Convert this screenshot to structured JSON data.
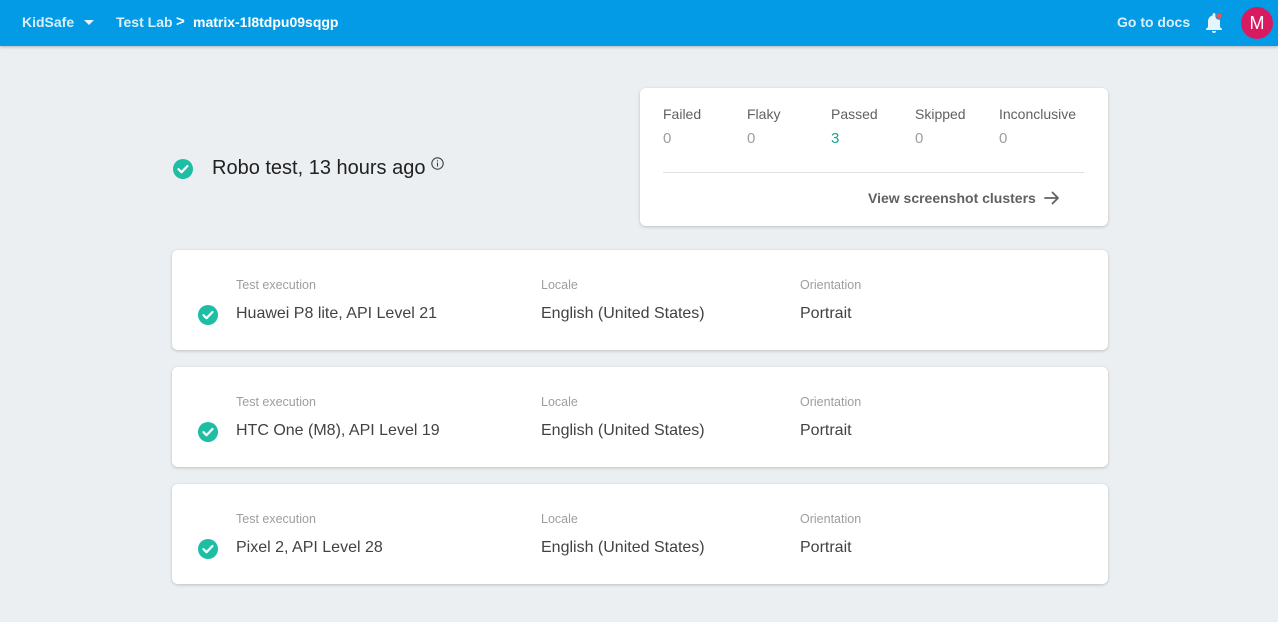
{
  "header": {
    "project": "KidSafe",
    "breadcrumb_parent": "Test Lab",
    "breadcrumb_separator": ">",
    "breadcrumb_current": "matrix-1l8tdpu09sqgp",
    "docs_link": "Go to docs",
    "avatar_letter": "M",
    "bar_color": "#039be5",
    "avatar_color": "#d81b60"
  },
  "summary": {
    "title": "Robo test, 13 hours ago",
    "status": "passed",
    "status_color": "#1ebea5"
  },
  "stats": {
    "failed_label": "Failed",
    "failed_value": "0",
    "flaky_label": "Flaky",
    "flaky_value": "0",
    "passed_label": "Passed",
    "passed_value": "3",
    "skipped_label": "Skipped",
    "skipped_value": "0",
    "inconclusive_label": "Inconclusive",
    "inconclusive_value": "0",
    "clusters_link": "View screenshot clusters"
  },
  "executions": [
    {
      "exec_label": "Test execution",
      "device": "Huawei P8 lite, API Level 21",
      "locale_label": "Locale",
      "locale": "English (United States)",
      "orientation_label": "Orientation",
      "orientation": "Portrait",
      "status": "passed"
    },
    {
      "exec_label": "Test execution",
      "device": "HTC One (M8), API Level 19",
      "locale_label": "Locale",
      "locale": "English (United States)",
      "orientation_label": "Orientation",
      "orientation": "Portrait",
      "status": "passed"
    },
    {
      "exec_label": "Test execution",
      "device": "Pixel 2, API Level 28",
      "locale_label": "Locale",
      "locale": "English (United States)",
      "orientation_label": "Orientation",
      "orientation": "Portrait",
      "status": "passed"
    }
  ]
}
